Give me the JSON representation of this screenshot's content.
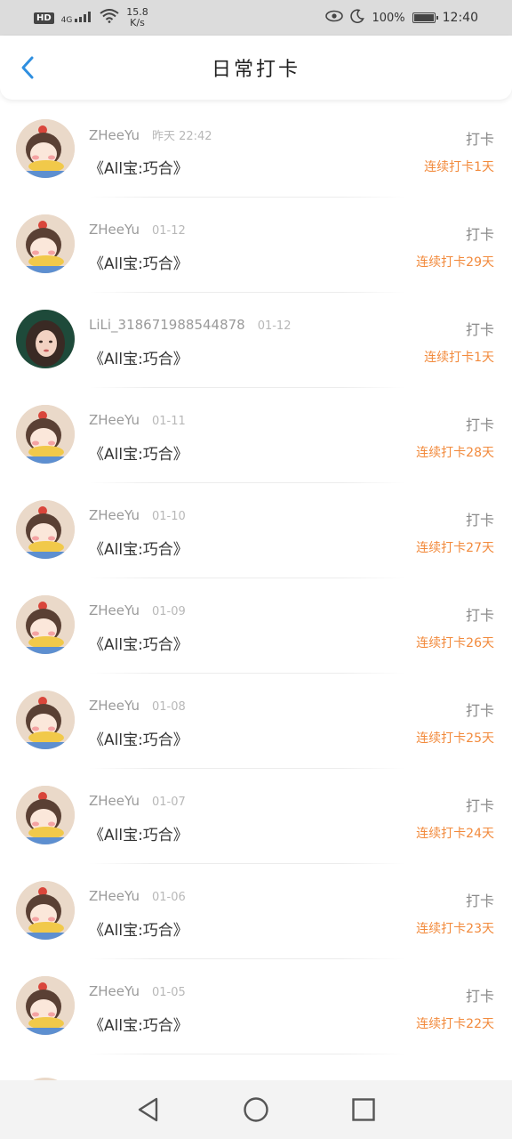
{
  "status_bar": {
    "hd": "HD",
    "signal": "4G",
    "net_speed_value": "15.8",
    "net_speed_unit": "K/s",
    "battery": "100%",
    "time": "12:40"
  },
  "header": {
    "title": "日常打卡",
    "back_icon": "chevron-left-icon"
  },
  "colors": {
    "accent": "#f28a3c",
    "back_arrow": "#2f8fe0"
  },
  "entries": [
    {
      "name": "ZHeeYu",
      "time": "昨天 22:42",
      "book": "《All宝:巧合》",
      "action": "打卡",
      "streak": "连续打卡1天",
      "avatar": "cartoon-girl"
    },
    {
      "name": "ZHeeYu",
      "time": "01-12",
      "book": "《All宝:巧合》",
      "action": "打卡",
      "streak": "连续打卡29天",
      "avatar": "cartoon-girl"
    },
    {
      "name": "LiLi_318671988544878",
      "time": "01-12",
      "book": "《All宝:巧合》",
      "action": "打卡",
      "streak": "连续打卡1天",
      "avatar": "photo-girl"
    },
    {
      "name": "ZHeeYu",
      "time": "01-11",
      "book": "《All宝:巧合》",
      "action": "打卡",
      "streak": "连续打卡28天",
      "avatar": "cartoon-girl"
    },
    {
      "name": "ZHeeYu",
      "time": "01-10",
      "book": "《All宝:巧合》",
      "action": "打卡",
      "streak": "连续打卡27天",
      "avatar": "cartoon-girl"
    },
    {
      "name": "ZHeeYu",
      "time": "01-09",
      "book": "《All宝:巧合》",
      "action": "打卡",
      "streak": "连续打卡26天",
      "avatar": "cartoon-girl"
    },
    {
      "name": "ZHeeYu",
      "time": "01-08",
      "book": "《All宝:巧合》",
      "action": "打卡",
      "streak": "连续打卡25天",
      "avatar": "cartoon-girl"
    },
    {
      "name": "ZHeeYu",
      "time": "01-07",
      "book": "《All宝:巧合》",
      "action": "打卡",
      "streak": "连续打卡24天",
      "avatar": "cartoon-girl"
    },
    {
      "name": "ZHeeYu",
      "time": "01-06",
      "book": "《All宝:巧合》",
      "action": "打卡",
      "streak": "连续打卡23天",
      "avatar": "cartoon-girl"
    },
    {
      "name": "ZHeeYu",
      "time": "01-05",
      "book": "《All宝:巧合》",
      "action": "打卡",
      "streak": "连续打卡22天",
      "avatar": "cartoon-girl"
    }
  ],
  "nav_bar": {
    "back_icon": "triangle-back-icon",
    "home_icon": "circle-home-icon",
    "recents_icon": "square-recents-icon"
  }
}
